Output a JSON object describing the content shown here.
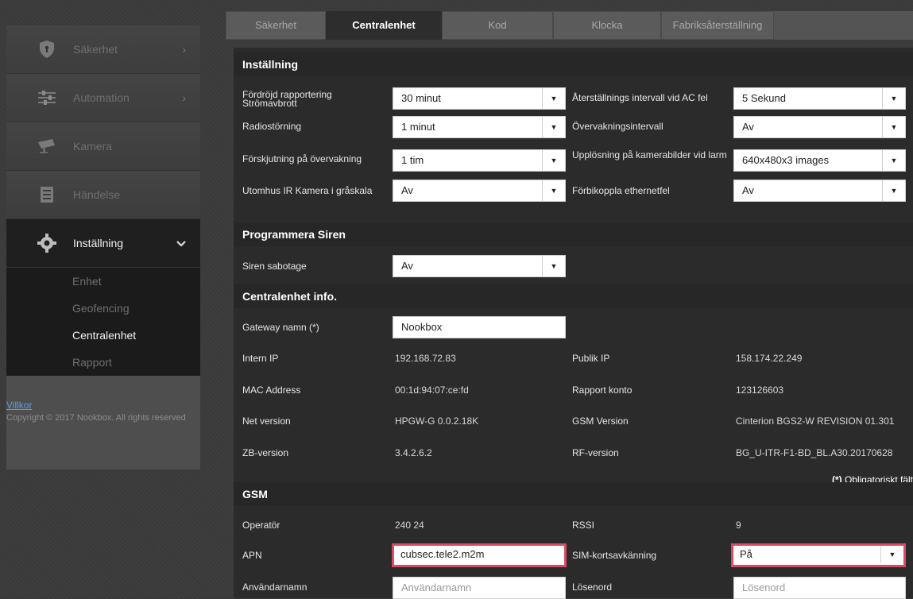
{
  "sidebar": {
    "items": [
      {
        "label": "Säkerhet",
        "icon": "shield-icon",
        "chevron": "›"
      },
      {
        "label": "Automation",
        "icon": "sliders-icon",
        "chevron": "›"
      },
      {
        "label": "Kamera",
        "icon": "camera-icon"
      },
      {
        "label": "Händelse",
        "icon": "list-icon"
      },
      {
        "label": "Inställning",
        "icon": "gear-icon",
        "chevron": "⌄"
      }
    ],
    "sub_items": [
      "Enhet",
      "Geofencing",
      "Centralenhet",
      "Rapport"
    ],
    "footer_link": "Villkor",
    "copyright": "Copyright © 2017 Nookbox. All rights reserved"
  },
  "tabs": [
    "Säkerhet",
    "Centralenhet",
    "Kod",
    "Klocka",
    "Fabriksåterställning"
  ],
  "sections": {
    "installning": "Inställning",
    "siren": "Programmera Siren",
    "info": "Centralenhet info.",
    "gsm": "GSM"
  },
  "settings": {
    "r1": {
      "label_l": "Fördröjd rapportering Strömavbrott",
      "value_l": "30 minut",
      "label_r": "Återställnings intervall vid AC fel",
      "value_r": "5 Sekund"
    },
    "r2": {
      "label_l": "Radiostörning",
      "value_l": "1 minut",
      "label_r": "Övervakningsintervall",
      "value_r": "Av"
    },
    "r3": {
      "label_l": "Förskjutning på övervakning",
      "value_l": "1 tim",
      "label_r": "Upplösning på kamerabilder vid larm",
      "value_r": "640x480x3 images"
    },
    "r4": {
      "label_l": "Utomhus IR Kamera i gråskala",
      "value_l": "Av",
      "label_r": "Förbikoppla ethernetfel",
      "value_r": "Av"
    }
  },
  "siren": {
    "label": "Siren sabotage",
    "value": "Av"
  },
  "info": {
    "gateway_label": "Gateway namn (*)",
    "gateway_value": "Nookbox",
    "intern_ip_label": "Intern IP",
    "intern_ip": "192.168.72.83",
    "publik_ip_label": "Publik IP",
    "publik_ip": "158.174.22.249",
    "mac_label": "MAC Address",
    "mac": "00:1d:94:07:ce:fd",
    "rapport_label": "Rapport konto",
    "rapport": "123126603",
    "net_label": "Net version",
    "net": "HPGW-G 0.0.2.18K",
    "gsm_ver_label": "GSM Version",
    "gsm_ver": "Cinterion BGS2-W REVISION 01.301",
    "zb_label": "ZB-version",
    "zb": "3.4.2.6.2",
    "rf_label": "RF-version",
    "rf": "BG_U-ITR-F1-BD_BL.A30.20170628",
    "required_mark": "(*)",
    "required_text": " Obligatoriskt fält"
  },
  "gsm": {
    "operator_label": "Operatör",
    "operator": "240 24",
    "rssi_label": "RSSI",
    "rssi": "9",
    "apn_label": "APN",
    "apn": "cubsec.tele2.m2m",
    "sim_label": "SIM-kortsavkänning",
    "sim": "På",
    "user_label": "Användarnamn",
    "user_placeholder": "Användarnamn",
    "pass_label": "Lösenord",
    "pass_placeholder": "Lösenord"
  },
  "colors": {
    "highlight": "#d94b62",
    "link": "#5aa0e0"
  }
}
